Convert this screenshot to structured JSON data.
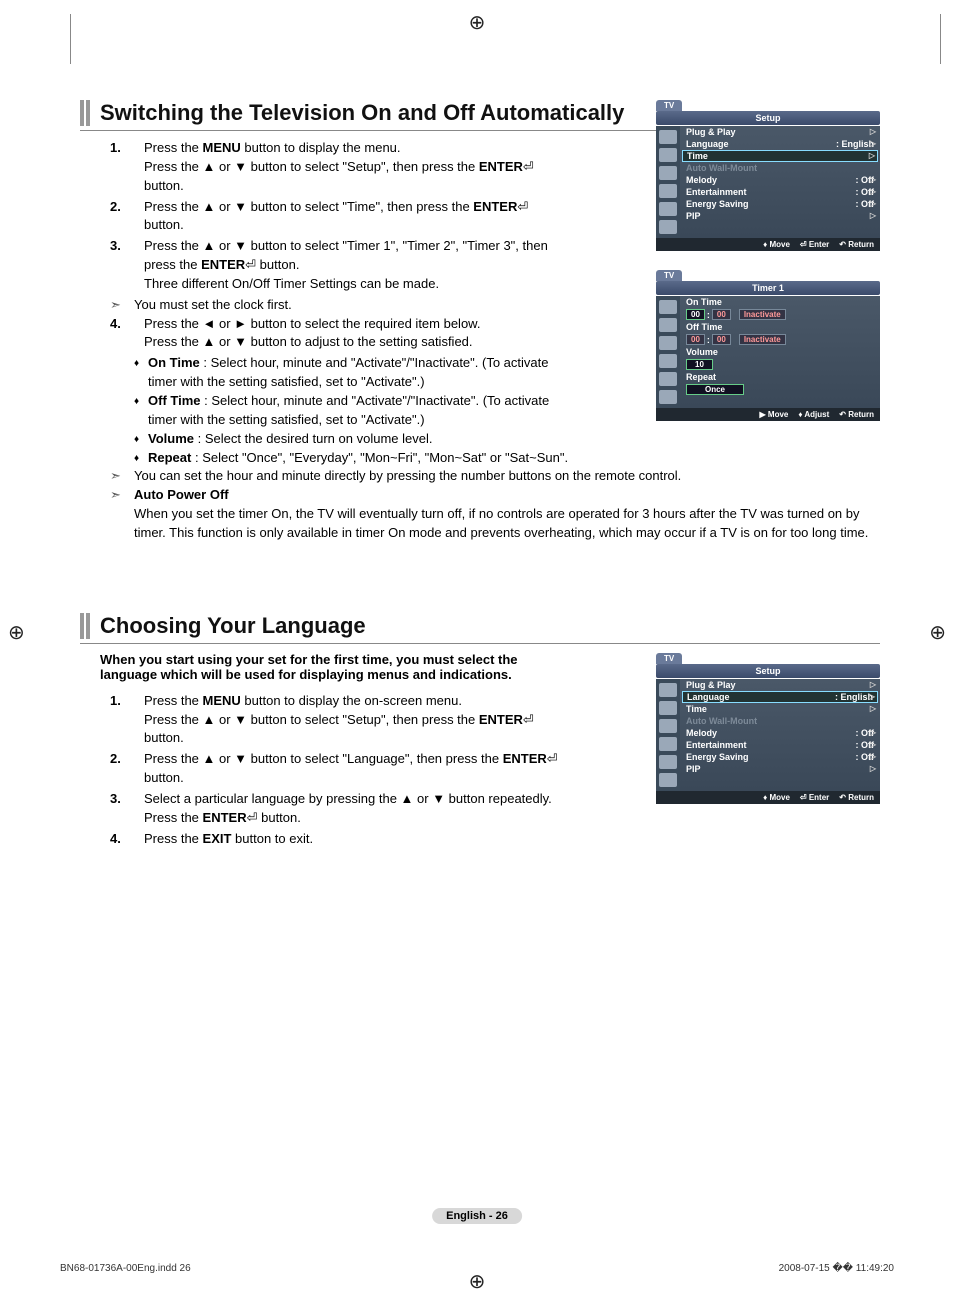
{
  "section1": {
    "title": "Switching the Television On and Off Automatically",
    "s1": {
      "a": "Press the ",
      "menu": "MENU",
      "b": " button to display the menu.",
      "c": "Press the ▲ or ▼ button to select \"Setup\", then press the ",
      "enter": "ENTER",
      "btn": "button."
    },
    "s2": {
      "a": "Press the ▲ or ▼ button to select \"Time\", then press the ",
      "enter": "ENTER",
      "btn": "button."
    },
    "s3": {
      "a": "Press the ▲ or ▼ button to select \"Timer 1\", \"Timer 2\", \"Timer 3\", then press the ",
      "enter": "ENTER",
      "btn": "button.",
      "c": "Three different On/Off Timer Settings can be made."
    },
    "note1": "You must set the clock first.",
    "s4": {
      "a": "Press the ◄ or ► button to select the required item below.",
      "b": "Press the ▲ or ▼ button to adjust to the setting satisfied."
    },
    "b1": {
      "t": "On Time",
      "d": " : Select hour, minute and \"Activate\"/\"Inactivate\". (To activate timer with the setting satisfied, set to \"Activate\".)"
    },
    "b2": {
      "t": "Off Time",
      "d": " : Select hour, minute and \"Activate\"/\"Inactivate\". (To activate timer with the setting satisfied, set to \"Activate\".)"
    },
    "b3": {
      "t": "Volume",
      "d": " : Select the desired turn on volume level."
    },
    "b4": {
      "t": "Repeat",
      "d": " : Select \"Once\", \"Everyday\", \"Mon~Fri\", \"Mon~Sat\" or \"Sat~Sun\"."
    },
    "note2": "You can set the hour and minute directly by pressing the number buttons on the remote control.",
    "apo_t": "Auto Power Off",
    "apo_d": "When you set the timer On, the TV will eventually turn off, if no controls are operated for 3 hours after the TV was turned on by timer. This function is only available in timer On mode and prevents overheating, which may occur if a TV is on for too long time."
  },
  "section2": {
    "title": "Choosing Your Language",
    "intro": "When you start using your set for the first time, you must select the language which will be used for displaying menus and indications.",
    "s1": {
      "a": "Press the ",
      "menu": "MENU",
      "b": " button to display the on-screen menu.",
      "c": "Press the ▲ or ▼ button to select \"Setup\", then press the ",
      "enter": "ENTER",
      "btn": "button."
    },
    "s2": {
      "a": "Press the ▲ or ▼ button to select \"Language\", then press the ",
      "enter": "ENTER",
      "btn": "button."
    },
    "s3": {
      "a": "Select a particular language by pressing the ▲ or ▼ button repeatedly.",
      "b": "Press the ",
      "enter": "ENTER",
      "btn": "button."
    },
    "s4": {
      "a": "Press the ",
      "exit": "EXIT",
      "b": " button to exit."
    }
  },
  "osd": {
    "tab": "TV",
    "setup": "Setup",
    "timer1": "Timer 1",
    "plug": "Plug & Play",
    "lang": "Language",
    "lang_v": ": English",
    "time": "Time",
    "awm": "Auto Wall-Mount",
    "mel": "Melody",
    "mel_v": ": Off",
    "ent": "Entertainment",
    "ent_v": ": Off",
    "es": "Energy Saving",
    "es_v": ": Off",
    "pip": "PIP",
    "move": "Move",
    "enter": "Enter",
    "return": "Return",
    "adjust": "Adjust",
    "on": "On Time",
    "off": "Off Time",
    "vol": "Volume",
    "rep": "Repeat",
    "h": "00",
    "m": "00",
    "inact": "Inactivate",
    "v10": "10",
    "once": "Once"
  },
  "pageNum": "English - 26",
  "footer": {
    "file": "BN68-01736A-00Eng.indd   26",
    "ts": "2008-07-15   �� 11:49:20"
  }
}
